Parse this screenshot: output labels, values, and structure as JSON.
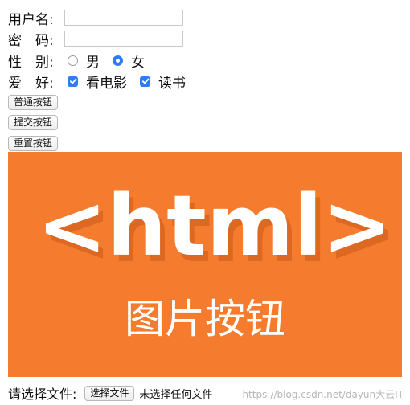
{
  "form": {
    "username_label": "用户名:",
    "username_value": "",
    "password_label": "密　码:",
    "password_value": "",
    "gender_label": "性　别:",
    "gender_options": [
      {
        "label": "男",
        "selected": false
      },
      {
        "label": "女",
        "selected": true
      }
    ],
    "hobby_label": "爱　好:",
    "hobby_options": [
      {
        "label": "看电影",
        "checked": true
      },
      {
        "label": "读书",
        "checked": true
      }
    ]
  },
  "buttons": {
    "normal": "普通按钮",
    "submit": "提交按钮",
    "reset": "重置按钮"
  },
  "image_button": {
    "logo_text": "<html>",
    "caption": "图片按钮",
    "colors": {
      "background": "#f57c2f",
      "text": "#ffffff",
      "shadow": "#d86520"
    }
  },
  "file": {
    "label": "请选择文件:",
    "button": "选择文件",
    "status": "未选择任何文件"
  },
  "watermark": "https://blog.csdn.net/dayun大云IT"
}
